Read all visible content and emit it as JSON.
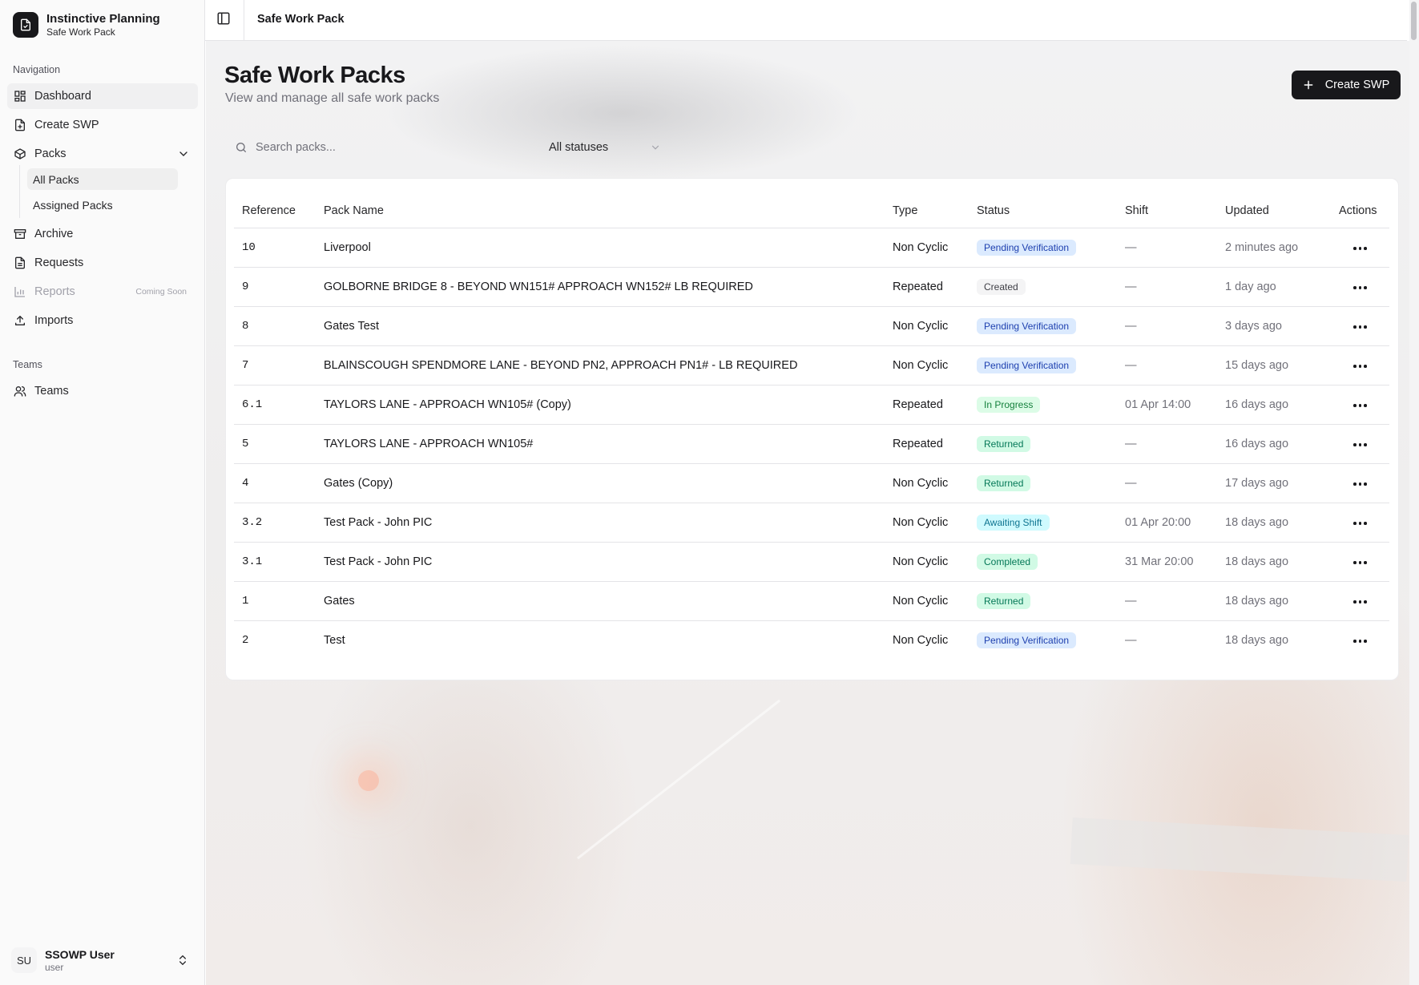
{
  "brand": {
    "title": "Instinctive Planning",
    "subtitle": "Safe Work Pack"
  },
  "sidebar": {
    "navigation_label": "Navigation",
    "items": [
      {
        "label": "Dashboard",
        "icon": "dashboard-icon"
      },
      {
        "label": "Create SWP",
        "icon": "file-plus-icon"
      },
      {
        "label": "Packs",
        "icon": "package-icon"
      },
      {
        "label": "Archive",
        "icon": "archive-icon"
      },
      {
        "label": "Requests",
        "icon": "file-text-icon"
      },
      {
        "label": "Reports",
        "icon": "bar-chart-icon",
        "note": "Coming Soon"
      },
      {
        "label": "Imports",
        "icon": "upload-icon"
      }
    ],
    "packs_sub": [
      "All Packs",
      "Assigned Packs"
    ],
    "teams_label": "Teams",
    "teams_item": "Teams"
  },
  "user": {
    "initials": "SU",
    "name": "SSOWP User",
    "role": "user"
  },
  "topbar": {
    "title": "Safe Work Pack"
  },
  "page": {
    "title": "Safe Work Packs",
    "subtitle": "View and manage all safe work packs",
    "create_label": "Create SWP"
  },
  "filters": {
    "search_placeholder": "Search packs...",
    "status_value": "All statuses"
  },
  "table": {
    "headers": [
      "Reference",
      "Pack Name",
      "Type",
      "Status",
      "Shift",
      "Updated",
      "Actions"
    ],
    "rows": [
      {
        "ref": "10",
        "name": "Liverpool",
        "type": "Non Cyclic",
        "status": "Pending Verification",
        "shift": "—",
        "updated": "2 minutes ago"
      },
      {
        "ref": "9",
        "name": "GOLBORNE BRIDGE 8 - BEYOND WN151# APPROACH WN152# LB REQUIRED",
        "type": "Repeated",
        "status": "Created",
        "shift": "—",
        "updated": "1 day ago"
      },
      {
        "ref": "8",
        "name": "Gates Test",
        "type": "Non Cyclic",
        "status": "Pending Verification",
        "shift": "—",
        "updated": "3 days ago"
      },
      {
        "ref": "7",
        "name": "BLAINSCOUGH SPENDMORE LANE - BEYOND PN2, APPROACH PN1# - LB REQUIRED",
        "type": "Non Cyclic",
        "status": "Pending Verification",
        "shift": "—",
        "updated": "15 days ago"
      },
      {
        "ref": "6.1",
        "name": "TAYLORS LANE - APPROACH WN105# (Copy)",
        "type": "Repeated",
        "status": "In Progress",
        "shift": "01 Apr 14:00",
        "updated": "16 days ago"
      },
      {
        "ref": "5",
        "name": "TAYLORS LANE - APPROACH WN105#",
        "type": "Repeated",
        "status": "Returned",
        "shift": "—",
        "updated": "16 days ago"
      },
      {
        "ref": "4",
        "name": "Gates (Copy)",
        "type": "Non Cyclic",
        "status": "Returned",
        "shift": "—",
        "updated": "17 days ago"
      },
      {
        "ref": "3.2",
        "name": "Test Pack - John PIC",
        "type": "Non Cyclic",
        "status": "Awaiting Shift",
        "shift": "01 Apr 20:00",
        "updated": "18 days ago"
      },
      {
        "ref": "3.1",
        "name": "Test Pack - John PIC",
        "type": "Non Cyclic",
        "status": "Completed",
        "shift": "31 Mar 20:00",
        "updated": "18 days ago"
      },
      {
        "ref": "1",
        "name": "Gates",
        "type": "Non Cyclic",
        "status": "Returned",
        "shift": "—",
        "updated": "18 days ago"
      },
      {
        "ref": "2",
        "name": "Test",
        "type": "Non Cyclic",
        "status": "Pending Verification",
        "shift": "—",
        "updated": "18 days ago"
      }
    ]
  },
  "status_colors": {
    "Pending Verification": {
      "bg": "#dbeafe",
      "fg": "#1e40af"
    },
    "Created": {
      "bg": "#f4f4f5",
      "fg": "#3f3f46"
    },
    "In Progress": {
      "bg": "#dcfce7",
      "fg": "#15803d"
    },
    "Returned": {
      "bg": "#d1fae5",
      "fg": "#047857"
    },
    "Awaiting Shift": {
      "bg": "#cffafe",
      "fg": "#0e7490"
    },
    "Completed": {
      "bg": "#d1fae5",
      "fg": "#047857"
    }
  }
}
